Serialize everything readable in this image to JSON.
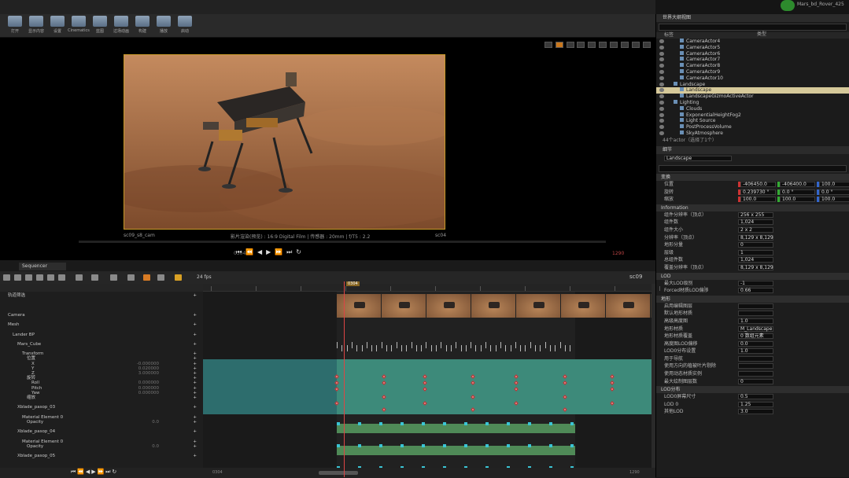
{
  "window": {
    "title": "Mars_bd_Rover_425"
  },
  "toolbar": {
    "items": [
      "打开",
      "显示内容",
      "设置",
      "Cinematics",
      "蓝图",
      "过场动画",
      "构建",
      "播放",
      "启动"
    ]
  },
  "viewport": {
    "info_left": "sc09_s8_cam",
    "info_center": "影片渲染(预览) : 16:9 Digital Film | 传感器 : 20mm | f/T5 : 2.2",
    "info_right": "sc04",
    "frame_left": "0304",
    "frame_right": "1290"
  },
  "outliner": {
    "tab": "世界大纲视图",
    "col_label": "标签",
    "col_type": "类型",
    "rows": [
      {
        "label": "CameraActor4",
        "level": 2,
        "selected": false
      },
      {
        "label": "CameraActor5",
        "level": 2,
        "selected": false
      },
      {
        "label": "CameraActor6",
        "level": 2,
        "selected": false
      },
      {
        "label": "CameraActor7",
        "level": 2,
        "selected": false
      },
      {
        "label": "CameraActor8",
        "level": 2,
        "selected": false
      },
      {
        "label": "CameraActor9",
        "level": 2,
        "selected": false
      },
      {
        "label": "CameraActor10",
        "level": 2,
        "selected": false
      },
      {
        "label": "Landscape",
        "level": 1,
        "selected": false
      },
      {
        "label": "Landscape",
        "level": 2,
        "selected": true
      },
      {
        "label": "LandscapeGizmoActiveActor",
        "level": 2,
        "selected": false
      },
      {
        "label": "Lighting",
        "level": 1,
        "selected": false
      },
      {
        "label": "Clouds",
        "level": 2,
        "selected": false
      },
      {
        "label": "ExponentialHeightFog2",
        "level": 2,
        "selected": false
      },
      {
        "label": "Light Source",
        "level": 2,
        "selected": false
      },
      {
        "label": "PostProcessVolume",
        "level": 2,
        "selected": false
      },
      {
        "label": "SkyAtmosphere",
        "level": 2,
        "selected": false
      }
    ],
    "status": "44个actor（选择了1个）"
  },
  "details": {
    "tab": "细节",
    "name_value": "Landscape",
    "transform_section": "变换",
    "transform": [
      {
        "label": "位置",
        "x": "-406450.0",
        "y": "-406400.0",
        "z": "100.0"
      },
      {
        "label": "旋转",
        "x": "0.239730 °",
        "y": "0.0 °",
        "z": "0.0 °"
      },
      {
        "label": "缩放",
        "x": "100.0",
        "y": "100.0",
        "z": "100.0"
      }
    ],
    "info_section": "Information",
    "info_rows": [
      {
        "label": "组件分辨率（顶点）",
        "value": "256 x 255"
      },
      {
        "label": "组件数",
        "value": "1,024"
      },
      {
        "label": "组件大小",
        "value": "2 x 2"
      },
      {
        "label": "分辨率（顶点）",
        "value": "8,129 x 8,129"
      },
      {
        "label": "地形分量",
        "value": "0"
      },
      {
        "label": "层级",
        "value": "1"
      },
      {
        "label": "总组件数",
        "value": "1,024"
      },
      {
        "label": "覆盖分辨率（顶点）",
        "value": "8,129 x 8,129"
      }
    ],
    "lod_section": "LOD",
    "lod_rows": [
      {
        "label": "最大LOD级别",
        "value": "-1"
      },
      {
        "label": "Forced材质LOD偏移",
        "value": "0.66"
      }
    ],
    "land_section": "地形",
    "land_rows": [
      {
        "label": "启用编辑图层",
        "value": ""
      },
      {
        "label": "默认地形材质",
        "value": ""
      },
      {
        "label": "高级高度图",
        "value": "1.0"
      },
      {
        "label": "地形材质",
        "value": "M_Landscape"
      },
      {
        "label": "地形材质覆盖",
        "value": "0 数组元素"
      },
      {
        "label": "高度图LOD偏移",
        "value": "0.0"
      },
      {
        "label": "LOD0分布设置",
        "value": "1.0"
      },
      {
        "label": "用于导航",
        "value": ""
      },
      {
        "label": "使用方向的植被叶片剔除",
        "value": ""
      },
      {
        "label": "使用动态材质实例",
        "value": ""
      },
      {
        "label": "最大绘制图层数",
        "value": "0"
      }
    ],
    "lod2_section": "LOD分布",
    "lod2_rows": [
      {
        "label": "LOD0屏幕尺寸",
        "value": "0.5"
      },
      {
        "label": "LOD 0",
        "value": "1.25"
      },
      {
        "label": "其他LOD",
        "value": "3.0"
      }
    ]
  },
  "sequencer": {
    "tab": "Sequencer",
    "seq_name": "sc09",
    "fps": "24 fps",
    "playhead": "0304",
    "tracks": [
      {
        "label": "轨道筛选",
        "indent": 1,
        "right": ""
      },
      {
        "label": "",
        "indent": 0,
        "right": ""
      },
      {
        "label": "",
        "indent": 0,
        "right": ""
      },
      {
        "label": "",
        "indent": 0,
        "right": ""
      },
      {
        "label": "Camera",
        "indent": 1,
        "right": ""
      },
      {
        "label": "",
        "indent": 0,
        "right": ""
      },
      {
        "label": "Mesh",
        "indent": 1,
        "right": ""
      },
      {
        "label": "",
        "indent": 0,
        "right": ""
      },
      {
        "label": "Lander BP",
        "indent": 2,
        "right": ""
      },
      {
        "label": "",
        "indent": 0,
        "right": ""
      },
      {
        "label": "Mars_Cube",
        "indent": 3,
        "right": ""
      },
      {
        "label": "",
        "indent": 0,
        "right": ""
      },
      {
        "label": "Transform",
        "indent": 4,
        "right": ""
      },
      {
        "label": "位置",
        "indent": 5,
        "right": ""
      },
      {
        "label": "X",
        "indent": 6,
        "right": "-0.000000"
      },
      {
        "label": "Y",
        "indent": 6,
        "right": "0.020000"
      },
      {
        "label": "Z",
        "indent": 6,
        "right": "3.000000"
      },
      {
        "label": "旋转",
        "indent": 5,
        "right": ""
      },
      {
        "label": "Roll",
        "indent": 6,
        "right": "0.000000"
      },
      {
        "label": "Pitch",
        "indent": 6,
        "right": "0.000000"
      },
      {
        "label": "Yaw",
        "indent": 6,
        "right": "0.000000"
      },
      {
        "label": "缩放",
        "indent": 5,
        "right": ""
      },
      {
        "label": "",
        "indent": 0,
        "right": ""
      },
      {
        "label": "Xblade_pasop_03",
        "indent": 3,
        "right": ""
      },
      {
        "label": "",
        "indent": 0,
        "right": ""
      },
      {
        "label": "Material Element 0",
        "indent": 4,
        "right": ""
      },
      {
        "label": "Opacity",
        "indent": 5,
        "right": "0.0"
      },
      {
        "label": "",
        "indent": 0,
        "right": ""
      },
      {
        "label": "Xblade_pasop_04",
        "indent": 3,
        "right": ""
      },
      {
        "label": "",
        "indent": 0,
        "right": ""
      },
      {
        "label": "Material Element 0",
        "indent": 4,
        "right": ""
      },
      {
        "label": "Opacity",
        "indent": 5,
        "right": "0.0"
      },
      {
        "label": "",
        "indent": 0,
        "right": ""
      },
      {
        "label": "Xblade_pasop_05",
        "indent": 3,
        "right": ""
      }
    ],
    "bottom_left": "0304",
    "bottom_right": "1290"
  }
}
